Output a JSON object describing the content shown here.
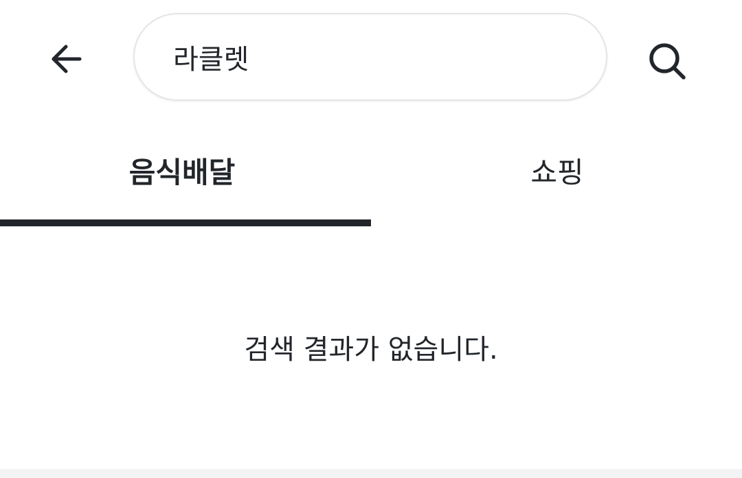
{
  "header": {
    "back_icon": "arrow-left-icon",
    "search": {
      "value": "라클렛",
      "placeholder": ""
    },
    "search_icon": "search-icon"
  },
  "tabs": [
    {
      "label": "음식배달",
      "active": true
    },
    {
      "label": "쇼핑",
      "active": false
    }
  ],
  "main": {
    "empty_message": "검색 결과가 없습니다."
  },
  "colors": {
    "text": "#22262b",
    "tab_indicator": "#22262b",
    "search_border": "#e3e5e8",
    "background": "#ffffff",
    "bottom_bar": "#f2f3f5"
  }
}
